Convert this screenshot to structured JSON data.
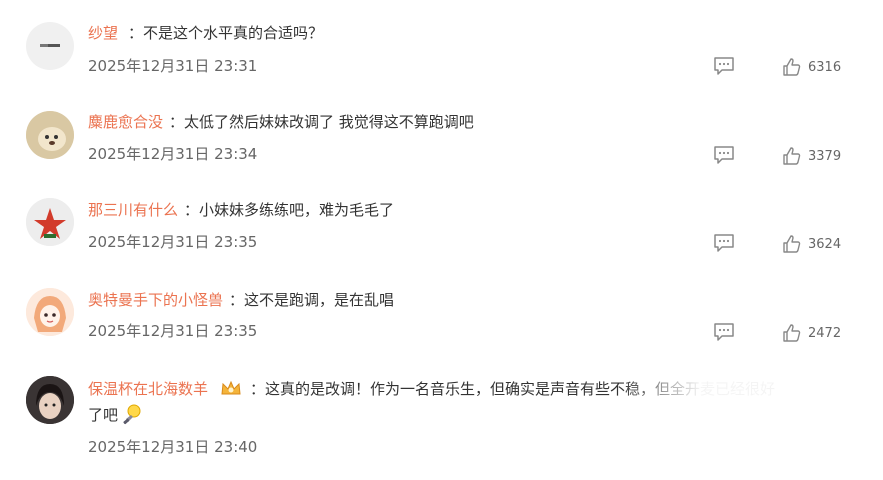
{
  "comments": [
    {
      "username": "纱望",
      "text": "：不是这个水平真的合适吗？",
      "time": "2025年12月31日 23:31",
      "likes": "6316"
    },
    {
      "username": "麋鹿愈合没",
      "text": "：太低了然后妹妹改调了 我觉得这不算跑调吧",
      "time": "2025年12月31日 23:34",
      "likes": "3379"
    },
    {
      "username": "那三川有什么",
      "text": "：小妹妹多练练吧，难为毛毛了",
      "time": "2025年12月31日 23:35",
      "likes": "3624"
    },
    {
      "username": "奥特曼手下的小怪兽",
      "text": "：这不是跑调，是在乱唱",
      "time": "2025年12月31日 23:35",
      "likes": "2472"
    },
    {
      "username": "保温杯在北海数羊",
      "text": "：这真的是改调！作为一名音乐生，但确实是声音有些不稳，但全开麦已经很好",
      "text_line2": "了吧",
      "time": "2025年12月31日 23:40"
    }
  ],
  "icons": {
    "reply": "comment-icon",
    "like": "thumbs-up-icon",
    "badge": "crown-badge-icon",
    "emoji": "lightbulb-emoji-icon"
  },
  "colors": {
    "username": "#eb7350",
    "text": "#333333",
    "meta": "#666666",
    "icon": "#888888"
  }
}
